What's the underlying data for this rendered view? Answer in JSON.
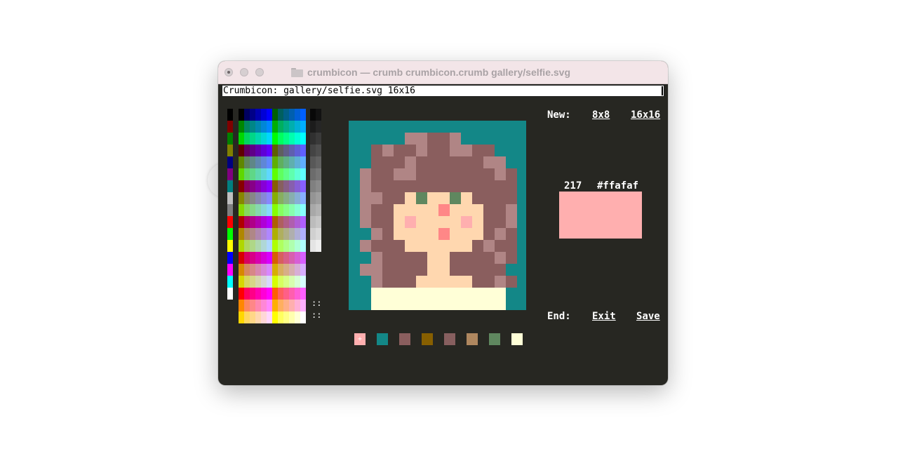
{
  "window": {
    "title": "crumbicon — crumb crumbicon.crumb gallery/selfie.svg",
    "icon": "folder-icon",
    "traffic_lights": [
      "close",
      "minimize",
      "maximize"
    ]
  },
  "command_line": {
    "text": "Crumbicon: gallery/selfie.svg 16x16"
  },
  "palette": {
    "basic": [
      "#000000",
      "#800000",
      "#008000",
      "#808000",
      "#000080",
      "#800080",
      "#008080",
      "#c0c0c0",
      "#808080",
      "#ff0000",
      "#00ff00",
      "#ffff00",
      "#0000ff",
      "#ff00ff",
      "#00ffff",
      "#ffffff"
    ],
    "cube_levels": [
      0,
      95,
      135,
      175,
      215,
      255
    ],
    "grays": [
      "#080808",
      "#121212",
      "#1c1c1c",
      "#262626",
      "#303030",
      "#3a3a3a",
      "#444444",
      "#4e4e4e",
      "#585858",
      "#626262",
      "#6c6c6c",
      "#767676",
      "#808080",
      "#8a8a8a",
      "#949494",
      "#9e9e9e",
      "#a8a8a8",
      "#b2b2b2",
      "#bcbcbc",
      "#c6c6c6",
      "#d0d0d0",
      "#dadada",
      "#e4e4e4",
      "#eeeeee"
    ],
    "more_indicator": "::"
  },
  "canvas": {
    "size": "16x16",
    "colors": {
      "T": "#138787",
      "H": "#8a5e5e",
      "h": "#b08585",
      "S": "#ffd7af",
      "E": "#5f875f",
      "P": "#ffafaf",
      "N": "#ff8787",
      "C": "#ffffd7"
    },
    "rows": [
      "TTTTTTTTTTTTTTTT",
      "TTTTThhHHhTTTTTT",
      "TTHhHHhHHhhHHTTT",
      "TTHHHhHHHHHHhhTT",
      "ThHHhhHHHHHHHhHT",
      "ThHHHHHHHHHHHHHT",
      "ThhHHSESSESHHHHT",
      "ThHHSSSSNSSSHHhT",
      "ThHHSPSSSSPSHHhT",
      "TThHSSSSNSSSHhHT",
      "ThHHHSSSSSSHhHHT",
      "TThHHHHSSHHHHhHT",
      "ThhHHHHSSHHHHHTT",
      "TThHHHSSSSSHHhHT",
      "TTCCCCCCCCCCCCTT",
      "TTCCCCCCCCCCCCTT"
    ]
  },
  "new_section": {
    "label": "New:",
    "options": [
      "8x8",
      "16x16"
    ]
  },
  "selected_color": {
    "index": "217",
    "hex": "#ffafaf"
  },
  "end_section": {
    "label": "End:",
    "exit": "Exit",
    "save": "Save"
  },
  "used_colors": [
    "#ffafaf",
    "#138787",
    "#8a5e5e",
    "#875f00",
    "#875f5f",
    "#af875f",
    "#5f875f",
    "#ffffd7"
  ]
}
